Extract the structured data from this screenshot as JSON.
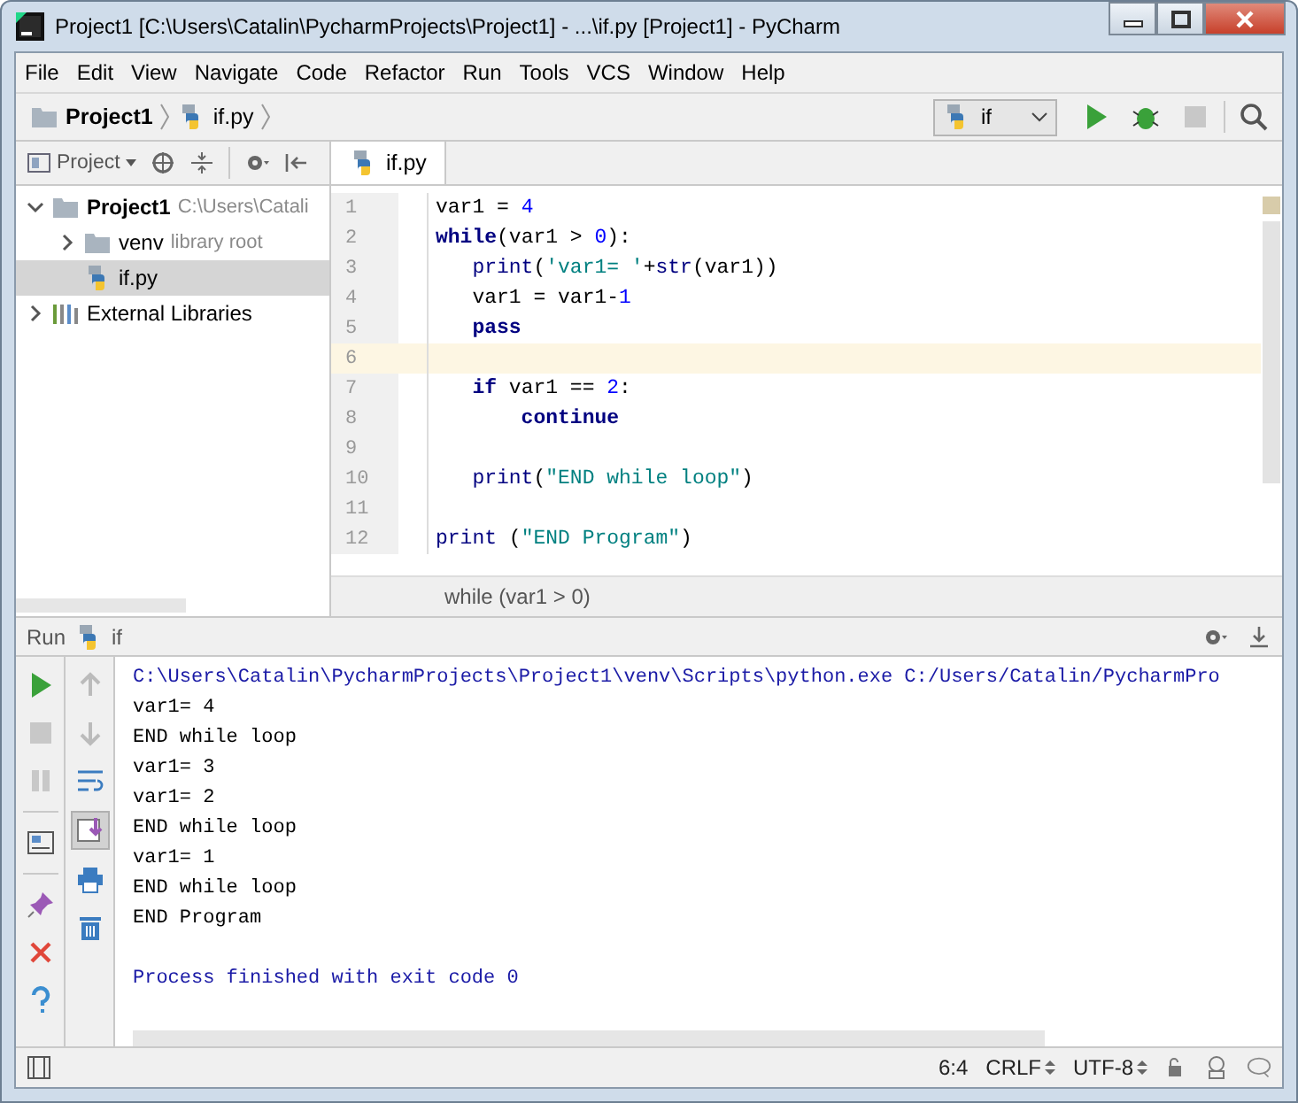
{
  "window": {
    "title": "Project1 [C:\\Users\\Catalin\\PycharmProjects\\Project1] - ...\\if.py [Project1] - PyCharm"
  },
  "menu": [
    "File",
    "Edit",
    "View",
    "Navigate",
    "Code",
    "Refactor",
    "Run",
    "Tools",
    "VCS",
    "Window",
    "Help"
  ],
  "navbar": {
    "crumbs": [
      {
        "label": "Project1",
        "kind": "folder"
      },
      {
        "label": "if.py",
        "kind": "python"
      }
    ],
    "run_config": "if"
  },
  "project_panel": {
    "title": "Project",
    "tree": [
      {
        "label": "Project1",
        "hint": "C:\\Users\\Catali",
        "kind": "folder",
        "expanded": true,
        "selected": false,
        "children": [
          {
            "label": "venv",
            "hint": "library root",
            "kind": "folder",
            "expanded": false,
            "selected": false
          },
          {
            "label": "if.py",
            "kind": "python",
            "selected": true
          }
        ]
      },
      {
        "label": "External Libraries",
        "kind": "library",
        "expanded": false,
        "selected": false
      }
    ]
  },
  "editor": {
    "tabs": [
      {
        "label": "if.py",
        "selected": true
      }
    ],
    "lines": [
      {
        "number": "1",
        "current": false,
        "tokens": [
          {
            "text": "var1 = ",
            "kind": "plain"
          },
          {
            "text": "4",
            "kind": "num"
          }
        ]
      },
      {
        "number": "2",
        "current": false,
        "tokens": [
          {
            "text": "while",
            "kind": "kw"
          },
          {
            "text": "(var1 > ",
            "kind": "plain"
          },
          {
            "text": "0",
            "kind": "num"
          },
          {
            "text": "):",
            "kind": "plain"
          }
        ]
      },
      {
        "number": "3",
        "current": false,
        "tokens": [
          {
            "text": "   print",
            "kind": "builtin"
          },
          {
            "text": "(",
            "kind": "plain"
          },
          {
            "text": "'var1= '",
            "kind": "str"
          },
          {
            "text": "+",
            "kind": "plain"
          },
          {
            "text": "str",
            "kind": "builtin"
          },
          {
            "text": "(var1))",
            "kind": "plain"
          }
        ]
      },
      {
        "number": "4",
        "current": false,
        "tokens": [
          {
            "text": "   var1 = var1-",
            "kind": "plain"
          },
          {
            "text": "1",
            "kind": "num"
          }
        ]
      },
      {
        "number": "5",
        "current": false,
        "tokens": [
          {
            "text": "   pass",
            "kind": "kw"
          }
        ]
      },
      {
        "number": "6",
        "current": true
      },
      {
        "number": "7",
        "current": false,
        "tokens": [
          {
            "text": "   if",
            "kind": "kw"
          },
          {
            "text": " var1 == ",
            "kind": "plain"
          },
          {
            "text": "2",
            "kind": "num"
          },
          {
            "text": ":",
            "kind": "plain"
          }
        ]
      },
      {
        "number": "8",
        "current": false,
        "tokens": [
          {
            "text": "       continue",
            "kind": "kw"
          }
        ]
      },
      {
        "number": "9",
        "current": false
      },
      {
        "number": "10",
        "current": false,
        "tokens": [
          {
            "text": "   print",
            "kind": "builtin"
          },
          {
            "text": "(",
            "kind": "plain"
          },
          {
            "text": "\"END while loop\"",
            "kind": "str"
          },
          {
            "text": ")",
            "kind": "plain"
          }
        ]
      },
      {
        "number": "11",
        "current": false
      },
      {
        "number": "12",
        "current": false,
        "tokens": [
          {
            "text": "print",
            "kind": "builtin"
          },
          {
            "text": " (",
            "kind": "plain"
          },
          {
            "text": "\"END Program\"",
            "kind": "str"
          },
          {
            "text": ")",
            "kind": "plain"
          }
        ]
      }
    ],
    "breadcrumb": "while (var1 > 0)"
  },
  "run": {
    "title": "Run",
    "config": "if",
    "output": [
      {
        "text": "C:\\Users\\Catalin\\PycharmProjects\\Project1\\venv\\Scripts\\python.exe C:/Users/Catalin/PycharmPro",
        "kind": "cmd"
      },
      {
        "text": "var1= 4",
        "kind": "out"
      },
      {
        "text": "END while loop",
        "kind": "out"
      },
      {
        "text": "var1= 3",
        "kind": "out"
      },
      {
        "text": "var1= 2",
        "kind": "out"
      },
      {
        "text": "END while loop",
        "kind": "out"
      },
      {
        "text": "var1= 1",
        "kind": "out"
      },
      {
        "text": "END while loop",
        "kind": "out"
      },
      {
        "text": "END Program",
        "kind": "out"
      },
      {
        "text": "Process finished with exit code 0",
        "kind": "exit"
      }
    ]
  },
  "status_bar": {
    "position": "6:4",
    "line_separator": "CRLF",
    "encoding": "UTF-8"
  }
}
